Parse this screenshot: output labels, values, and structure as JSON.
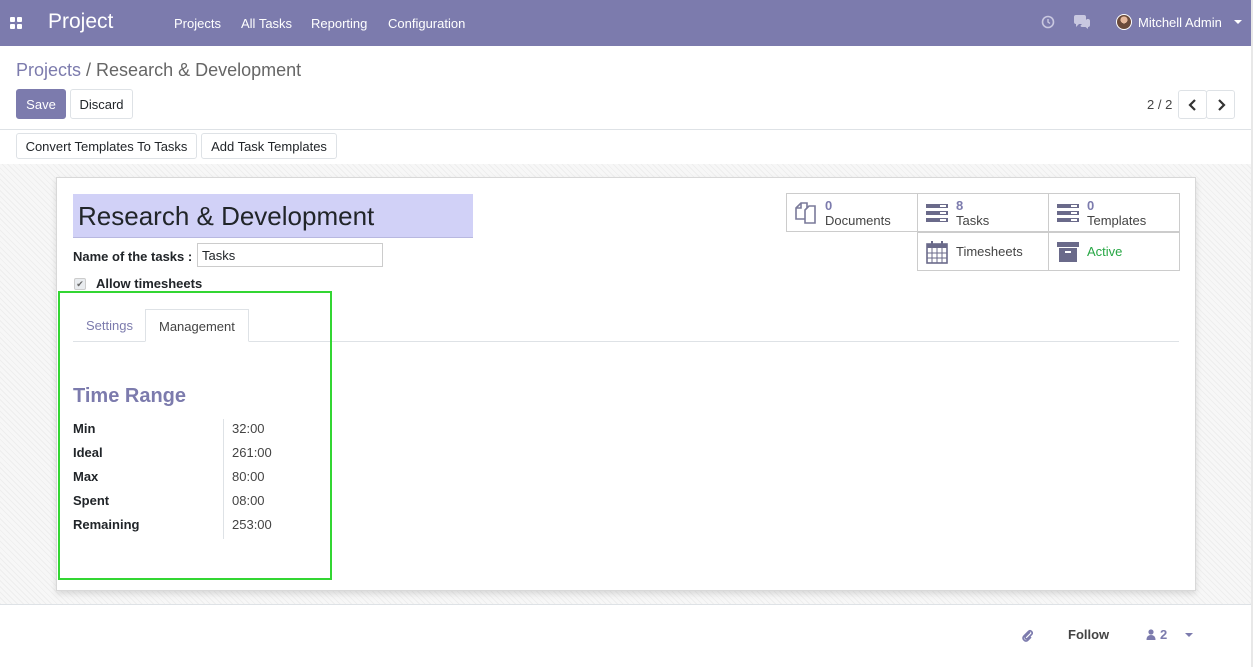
{
  "navbar": {
    "app_title": "Project",
    "menu": [
      "Projects",
      "All Tasks",
      "Reporting",
      "Configuration"
    ],
    "user_name": "Mitchell Admin"
  },
  "breadcrumb": {
    "parent": "Projects",
    "separator": "/",
    "current": "Research & Development"
  },
  "controls": {
    "save_label": "Save",
    "discard_label": "Discard",
    "pager": "2 / 2",
    "convert_label": "Convert Templates To Tasks",
    "add_templates_label": "Add Task Templates"
  },
  "form": {
    "project_name": "Research & Development",
    "task_name_label": "Name of the tasks :",
    "task_name_value": "Tasks",
    "allow_timesheets_label": "Allow timesheets",
    "allow_timesheets_checked": true
  },
  "smart_buttons": {
    "documents": {
      "count": "0",
      "label": "Documents"
    },
    "tasks": {
      "count": "8",
      "label": "Tasks"
    },
    "templates": {
      "count": "0",
      "label": "Templates"
    },
    "timesheets": {
      "label": "Timesheets"
    },
    "active": {
      "label": "Active",
      "color": "#28a745"
    }
  },
  "tabs": {
    "settings": "Settings",
    "management": "Management",
    "active": "Management"
  },
  "time_range": {
    "title": "Time Range",
    "rows": [
      {
        "label": "Min",
        "value": "32:00"
      },
      {
        "label": "Ideal",
        "value": "261:00"
      },
      {
        "label": "Max",
        "value": "80:00"
      },
      {
        "label": "Spent",
        "value": "08:00"
      },
      {
        "label": "Remaining",
        "value": "253:00"
      }
    ]
  },
  "chatter": {
    "follow_label": "Follow",
    "followers_count": "2"
  },
  "colors": {
    "brand": "#7c7bad",
    "title_bg": "#d1d1f7",
    "highlight": "#33d633"
  }
}
